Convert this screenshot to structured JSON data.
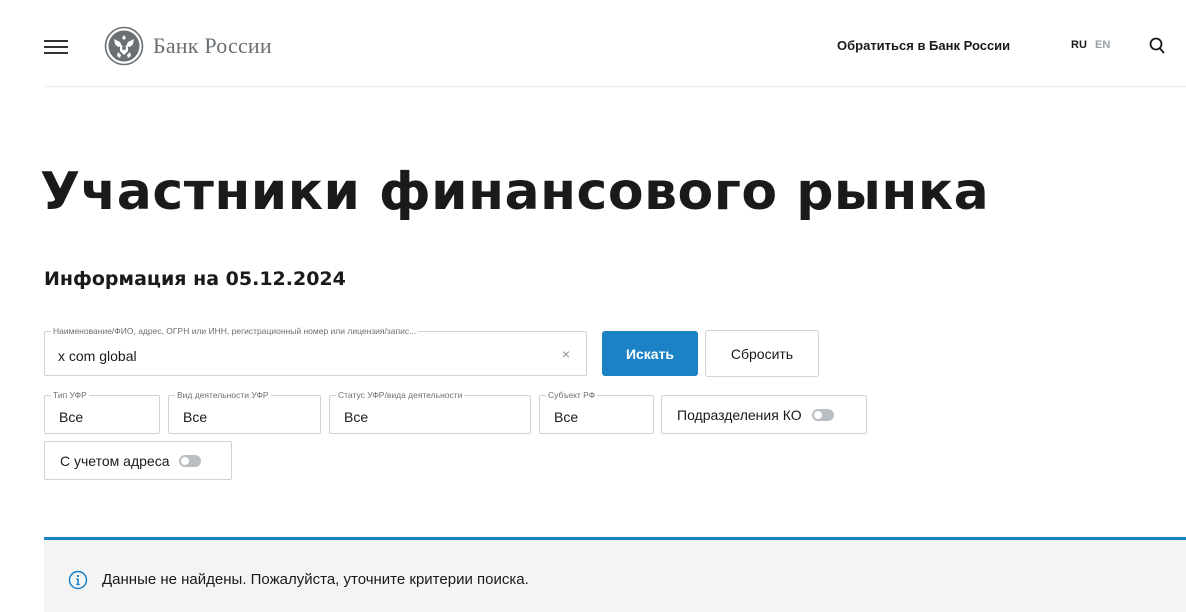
{
  "header": {
    "logo_text": "Банк России",
    "contact_label": "Обратиться в Банк России",
    "lang_ru": "RU",
    "lang_en": "EN"
  },
  "page": {
    "title": "Участники финансового рынка",
    "info_date": "Информация на 05.12.2024"
  },
  "search": {
    "legend": "Наименование/ФИО, адрес, ОГРН или ИНН, регистрационный номер или лицензия/запис...",
    "value": "x com global",
    "clear_symbol": "×",
    "search_label": "Искать",
    "reset_label": "Сбросить"
  },
  "filters": [
    {
      "legend": "Тип УФР",
      "value": "Все"
    },
    {
      "legend": "Вид деятельности УФР",
      "value": "Все"
    },
    {
      "legend": "Статус УФР/вида деятельности",
      "value": "Все"
    },
    {
      "legend": "Субъект РФ",
      "value": "Все"
    }
  ],
  "toggles": {
    "ko_label": "Подразделения КО",
    "ko_on": false,
    "address_label": "С учетом адреса",
    "address_on": false
  },
  "notice": {
    "text": "Данные не найдены. Пожалуйста, уточните критерии поиска."
  },
  "colors": {
    "accent": "#1a82c5",
    "notice_bg": "#f4f4f4",
    "logo_gray": "#6b7075"
  }
}
